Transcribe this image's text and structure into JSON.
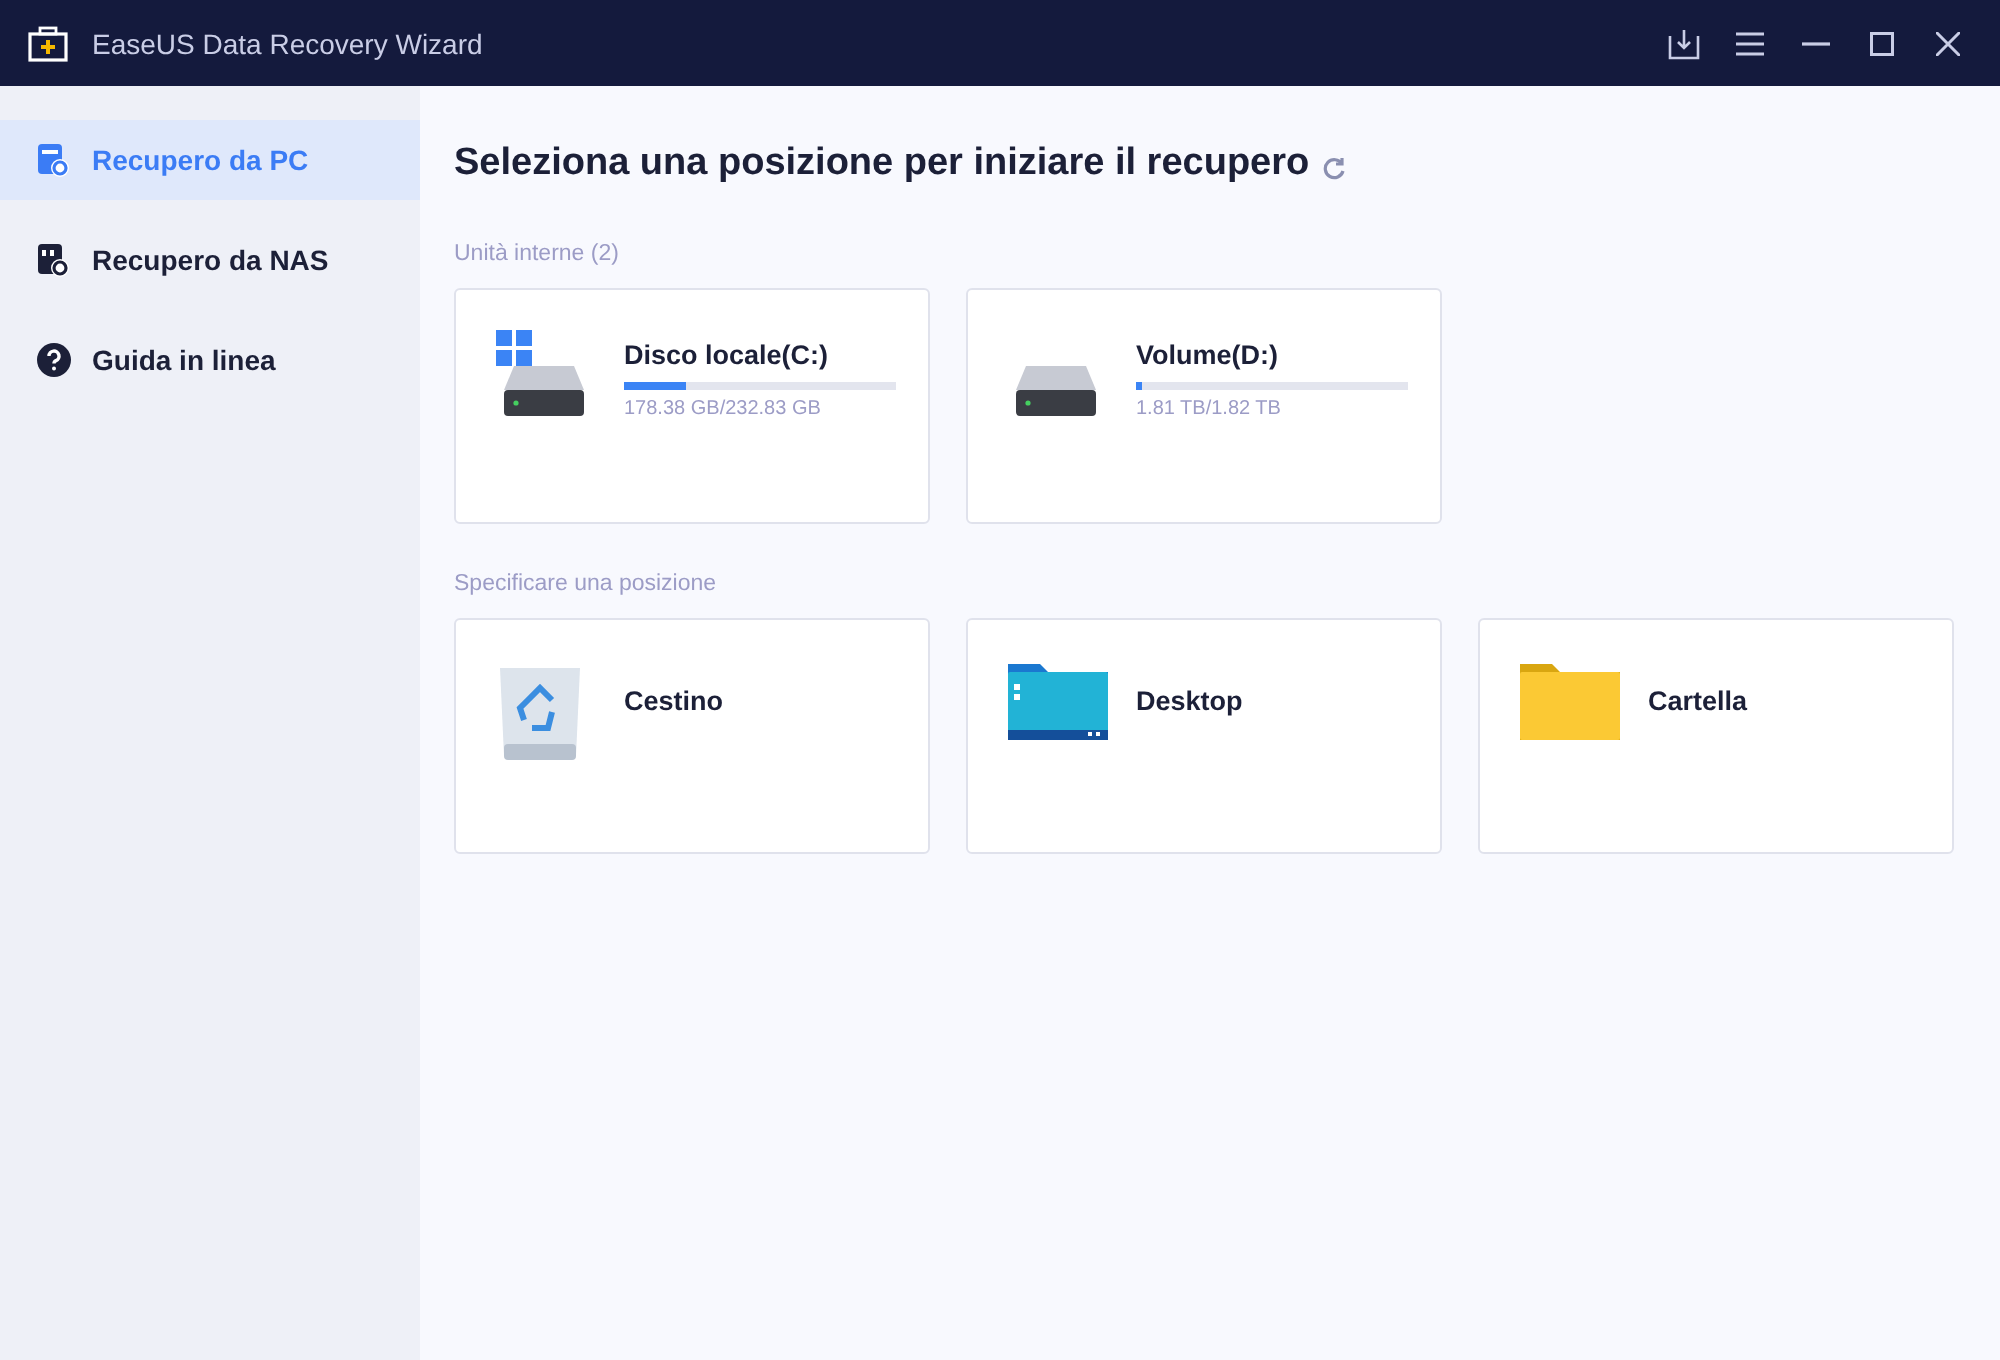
{
  "window": {
    "title": "EaseUS Data Recovery Wizard"
  },
  "sidebar": {
    "items": [
      {
        "label": "Recupero da PC",
        "kind": "pc",
        "selected": true
      },
      {
        "label": "Recupero da NAS",
        "kind": "nas",
        "selected": false
      },
      {
        "label": "Guida in linea",
        "kind": "help",
        "selected": false
      }
    ]
  },
  "main": {
    "heading": "Seleziona una posizione per iniziare il recupero",
    "sections": [
      {
        "title": "Unità interne (2)",
        "cards": [
          {
            "kind": "drive",
            "name": "Disco locale(C:)",
            "system": true,
            "level": 0.23,
            "usage": "178.38 GB/232.83 GB"
          },
          {
            "kind": "drive",
            "name": "Volume(D:)",
            "system": false,
            "level": 0.02,
            "usage": "1.81 TB/1.82 TB"
          }
        ]
      },
      {
        "title": "Specificare una posizione",
        "cards": [
          {
            "kind": "recycle",
            "name": "Cestino"
          },
          {
            "kind": "desktop",
            "name": "Desktop"
          },
          {
            "kind": "folder",
            "name": "Cartella"
          }
        ]
      }
    ]
  }
}
